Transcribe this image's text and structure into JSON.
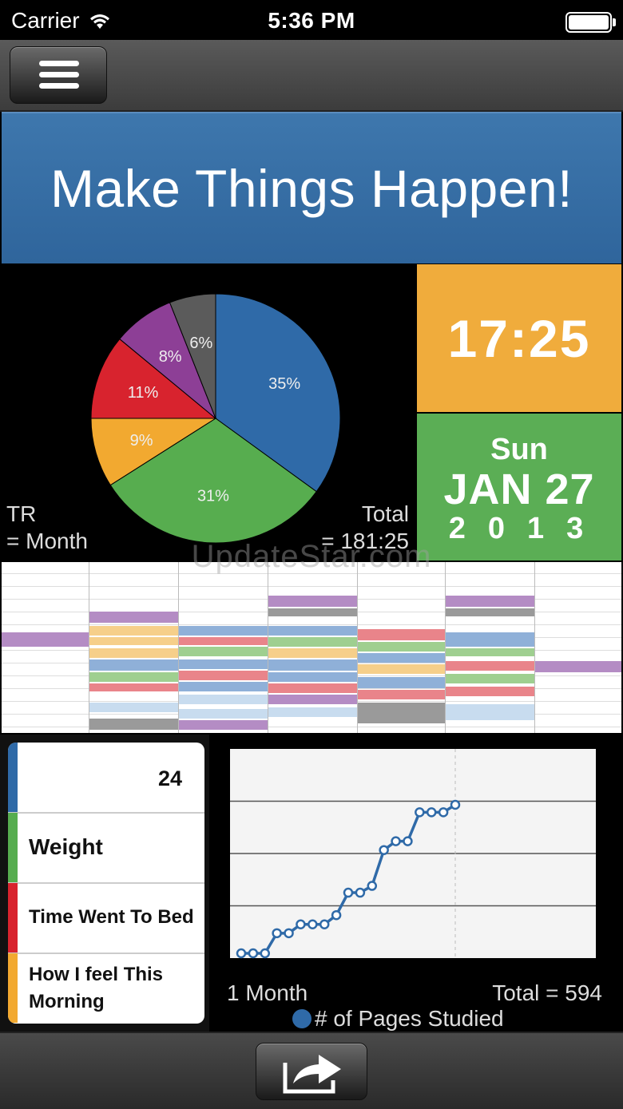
{
  "status_bar": {
    "carrier": "Carrier",
    "time": "5:36 PM"
  },
  "banner": {
    "title": "Make Things Happen!"
  },
  "pie": {
    "left_label_line1": "TR",
    "left_label_line2": "= Month",
    "right_label_line1": "Total",
    "right_label_line2": "= 181:25"
  },
  "chart_data": [
    {
      "type": "pie",
      "values": [
        35,
        31,
        9,
        11,
        8,
        6
      ],
      "labels": [
        "35%",
        "31%",
        "9%",
        "11%",
        "8%",
        "6%"
      ],
      "colors": [
        "#2f6aa8",
        "#57ad4f",
        "#f2a930",
        "#d8232e",
        "#8d3f96",
        "#5b5b5b"
      ]
    },
    {
      "type": "line",
      "series": [
        {
          "name": "# of Pages Studied",
          "values": [
            0,
            0,
            0,
            59,
            59,
            85,
            85,
            85,
            112,
            178,
            178,
            198,
            303,
            329,
            329,
            414,
            414,
            414,
            436
          ]
        }
      ],
      "ylim": [
        0,
        600
      ],
      "xlabel": "1 Month",
      "total_label": "Total = 594",
      "grid": true
    }
  ],
  "clock": {
    "time": "17:25"
  },
  "date": {
    "day": "Sun",
    "month_day": "JAN 27",
    "year": "2013"
  },
  "watermark": "UpdateStar.com",
  "trackers": [
    {
      "label": "",
      "value": "24",
      "color": "#2f6aa8"
    },
    {
      "label": "Weight",
      "value": "",
      "color": "#57ad4f"
    },
    {
      "label": "Time Went To Bed",
      "value": "",
      "color": "#d8232e"
    },
    {
      "label": "How I feel This Morning",
      "value": "",
      "color": "#f2a930"
    }
  ],
  "line_chart_labels": {
    "period": "1 Month",
    "total": "Total = 594",
    "legend": "# of Pages Studied"
  }
}
